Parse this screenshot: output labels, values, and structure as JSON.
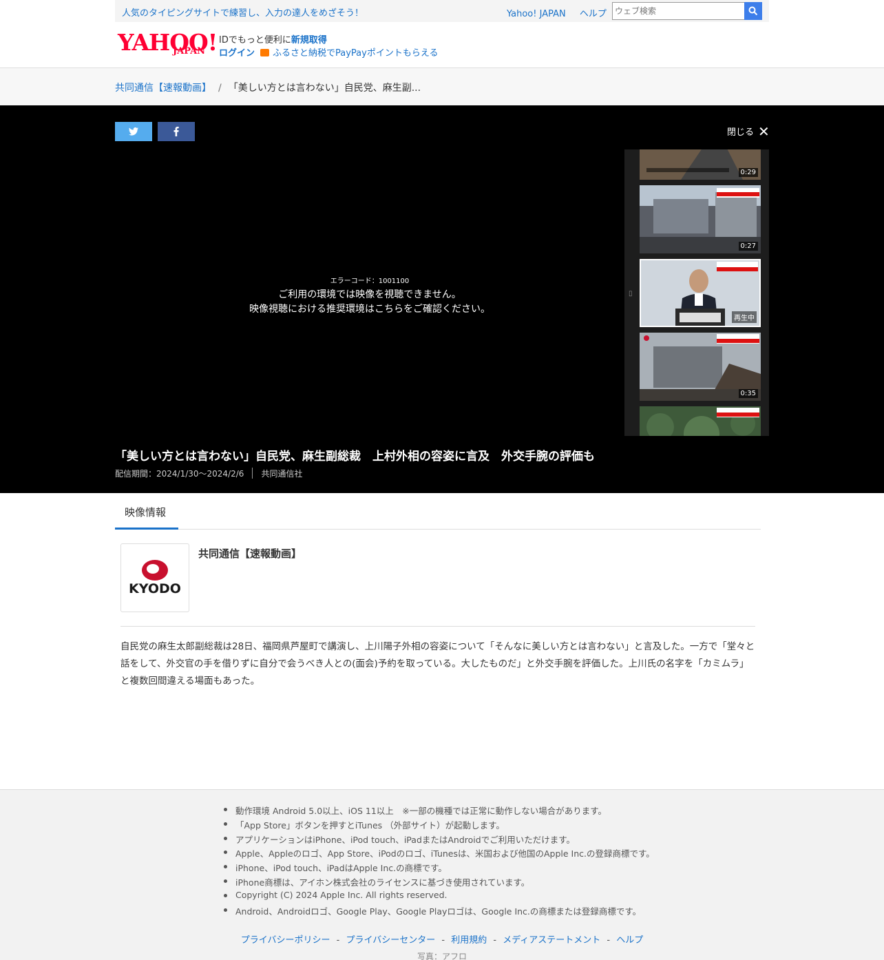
{
  "topbar": {
    "promo": "人気のタイピングサイトで練習し、入力の達人をめざそう！",
    "links": [
      "Yahoo! JAPAN",
      "ヘルプ"
    ],
    "search_placeholder": "ウェブ検索"
  },
  "logo": {
    "main": "YAHOO!",
    "sub": "JAPAN"
  },
  "account": {
    "prefix": "IDでもっと便利に",
    "register": "新規取得",
    "login": "ログイン",
    "promo": "ふるさと納税でPayPayポイントもらえる"
  },
  "breadcrumb": {
    "channel": "共同通信【速報動画】",
    "separator": "/",
    "current": "「美しい方とは言わない」自民党、麻生副..."
  },
  "player": {
    "close_label": "閉じる",
    "close_symbol": "✕",
    "error_code": "エラーコード：1001100",
    "error_msg1": "ご利用の環境では映像を視聴できません。",
    "error_msg2": "映像視聴における推奨環境はこちらをご確認ください。",
    "playing_label": "再生中",
    "thumbnails": [
      {
        "duration": "0:29",
        "scene": "road",
        "active": false
      },
      {
        "duration": "0:27",
        "scene": "building",
        "active": false
      },
      {
        "duration": "",
        "scene": "press",
        "active": true
      },
      {
        "duration": "0:35",
        "scene": "collapse",
        "active": false
      },
      {
        "duration": "",
        "scene": "forest",
        "active": false
      }
    ]
  },
  "video": {
    "title": "「美しい方とは言わない」自民党、麻生副総裁　上村外相の容姿に言及　外交手腕の評価も",
    "period": "配信期間：2024/1/30〜2024/2/6",
    "provider": "共同通信社"
  },
  "info": {
    "tab_label": "映像情報",
    "channel_name": "共同通信【速報動画】",
    "logo_text": "KYODO",
    "description": "自民党の麻生太郎副総裁は28日、福岡県芦屋町で講演し、上川陽子外相の容姿について「そんなに美しい方とは言わない」と言及した。一方で「堂々と話をして、外交官の手を借りずに自分で会うべき人との(面会)予約を取っている。大したものだ」と外交手腕を評価した。上川氏の名字を「カミムラ」と複数回間違える場面もあった。"
  },
  "footer": {
    "notes": [
      "動作環境 Android 5.0以上、iOS 11以上　※一部の機種では正常に動作しない場合があります。",
      "「App Store」ボタンを押すとiTunes （外部サイト）が起動します。",
      "アプリケーションはiPhone、iPod touch、iPadまたはAndroidでご利用いただけます。",
      "Apple、Appleのロゴ、App Store、iPodのロゴ、iTunesは、米国および他国のApple Inc.の登録商標です。",
      "iPhone、iPod touch、iPadはApple Inc.の商標です。",
      "iPhone商標は、アイホン株式会社のライセンスに基づき使用されています。",
      "Copyright (C) 2024 Apple Inc. All rights reserved.",
      "Android、Androidロゴ、Google Play、Google Playロゴは、Google Inc.の商標または登録商標です。"
    ],
    "links": [
      "プライバシーポリシー",
      "プライバシーセンター",
      "利用規約",
      "メディアステートメント",
      "ヘルプ"
    ],
    "link_separator": "-",
    "photo_credit": "写真：アフロ"
  },
  "colors": {
    "accent": "#1a72c9",
    "yahoo_red": "#ff0033",
    "twitter": "#55acee",
    "facebook": "#3b5998",
    "kyodo_red": "#c8102e"
  }
}
